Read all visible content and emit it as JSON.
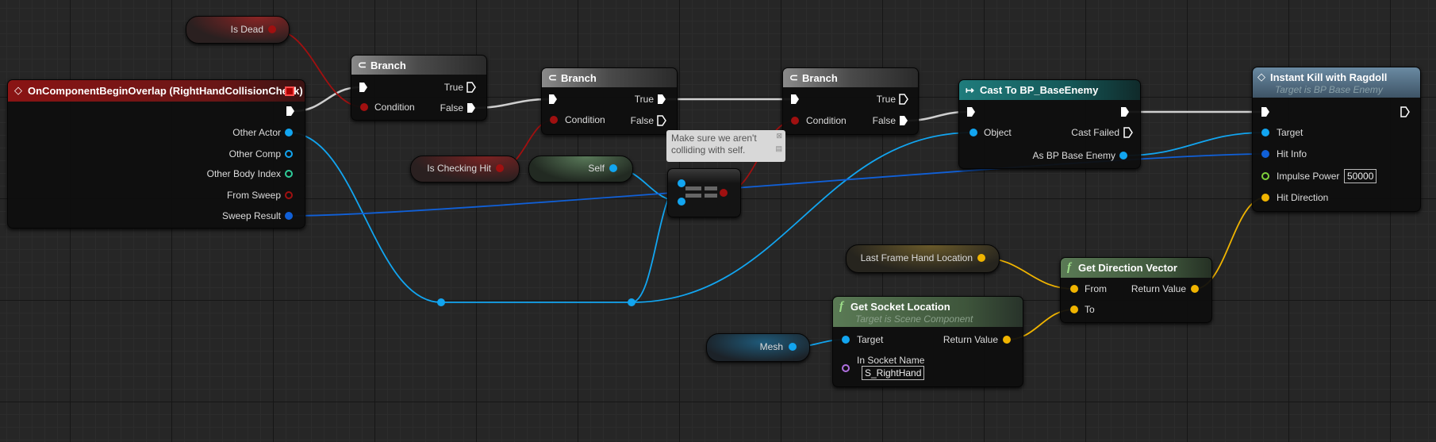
{
  "colors": {
    "exec": "#ffffff",
    "bool": "#a01010",
    "object": "#12a5f0",
    "struct": "#1060d8",
    "int": "#2fcc9a",
    "float": "#7fd13b",
    "vector": "#f0b400",
    "name": "#b070e0"
  },
  "event": {
    "title": "OnComponentBeginOverlap (RightHandCollisionCheck)",
    "icon": "event-diamond-icon",
    "pins": [
      "Other Actor",
      "Other Comp",
      "Other Body Index",
      "From Sweep",
      "Sweep Result"
    ]
  },
  "branch1": {
    "title": "Branch",
    "condition": "Condition",
    "true": "True",
    "false": "False"
  },
  "branch2": {
    "title": "Branch",
    "condition": "Condition",
    "true": "True",
    "false": "False"
  },
  "branch3": {
    "title": "Branch",
    "condition": "Condition",
    "true": "True",
    "false": "False"
  },
  "cast": {
    "title": "Cast To BP_BaseEnemy",
    "object": "Object",
    "cast_failed": "Cast Failed",
    "as": "As BP Base Enemy"
  },
  "instant_kill": {
    "title": "Instant Kill with Ragdoll",
    "subtitle": "Target is BP Base Enemy",
    "target": "Target",
    "hit_info": "Hit Info",
    "impulse_power": "Impulse Power",
    "impulse_value": "50000",
    "hit_direction": "Hit Direction"
  },
  "vars": {
    "is_dead": "Is Dead",
    "is_checking_hit": "Is Checking Hit",
    "self": "Self",
    "last_frame": "Last Frame Hand Location",
    "mesh": "Mesh"
  },
  "comment": {
    "text1": "Make sure we aren't",
    "text2": "colliding with self."
  },
  "direction": {
    "title": "Get Direction Vector",
    "from": "From",
    "to": "To",
    "ret": "Return Value"
  },
  "socket": {
    "title": "Get Socket Location",
    "subtitle": "Target is Scene Component",
    "target": "Target",
    "ret": "Return Value",
    "socket_label": "In Socket Name",
    "socket_value": "S_RightHand"
  }
}
